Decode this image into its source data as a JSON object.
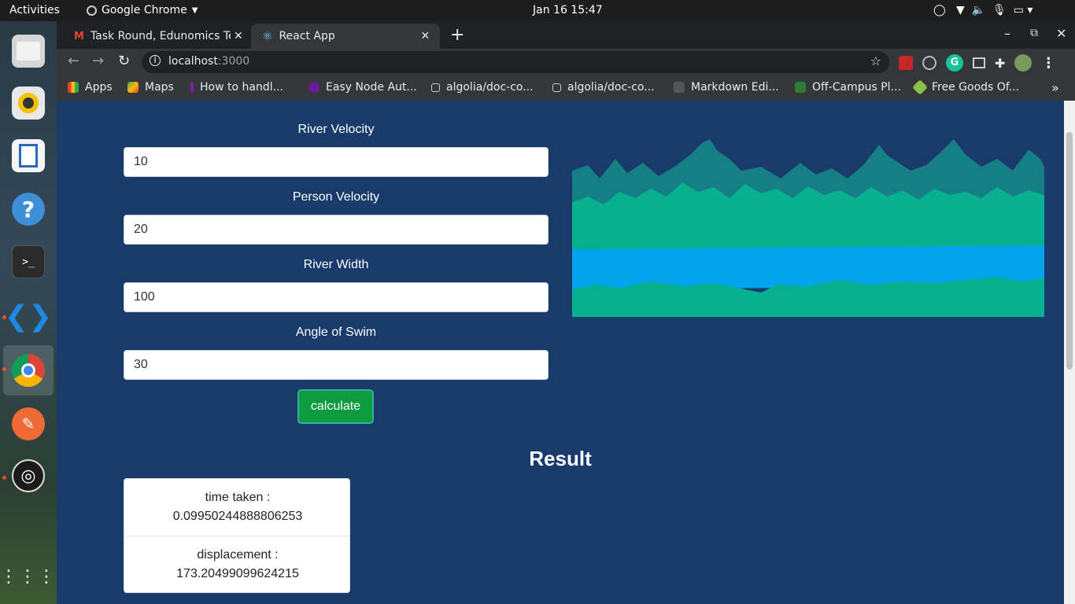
{
  "os": {
    "activities": "Activities",
    "app_menu": "Google Chrome",
    "clock": "Jan 16  15:47"
  },
  "browser": {
    "tabs": [
      {
        "title": "Task Round, Edunomics Te",
        "active": false
      },
      {
        "title": "React App",
        "active": true
      }
    ],
    "url_host": "localhost",
    "url_port": ":3000",
    "bookmarks": [
      {
        "label": "Apps"
      },
      {
        "label": "Maps"
      },
      {
        "label": "How to handl..."
      },
      {
        "label": "Easy Node Aut..."
      },
      {
        "label": "algolia/doc-co..."
      },
      {
        "label": "algolia/doc-co..."
      },
      {
        "label": "Markdown Edi..."
      },
      {
        "label": "Off-Campus Pl..."
      },
      {
        "label": "Free Goods Of..."
      }
    ]
  },
  "form": {
    "river_velocity_label": "River Velocity",
    "river_velocity_value": "10",
    "person_velocity_label": "Person Velocity",
    "person_velocity_value": "20",
    "river_width_label": "River Width",
    "river_width_value": "100",
    "angle_label": "Angle of Swim",
    "angle_value": "30",
    "calculate_label": "calculate"
  },
  "result": {
    "title": "Result",
    "time_label": "time taken :",
    "time_value": "0.09950244888806253",
    "displacement_label": "displacement :",
    "displacement_value": "173.20499099624215"
  },
  "colors": {
    "page_bg": "#183b6b",
    "button_green": "#0e9a3f",
    "forest_dark": "#167f85",
    "forest_light": "#07b08f",
    "river_blue": "#03a3ee"
  }
}
